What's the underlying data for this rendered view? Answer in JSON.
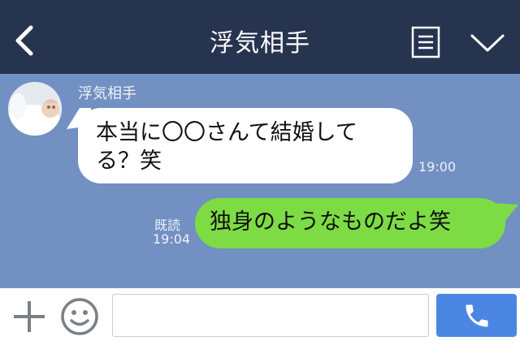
{
  "header": {
    "title": "浮気相手",
    "back_icon": "chevron-left-icon",
    "notes_icon": "notes-icon",
    "menu_icon": "chevron-down-icon",
    "background_color": "#26344f"
  },
  "chat": {
    "background_color": "#7290c2",
    "messages": [
      {
        "direction": "incoming",
        "sender": "浮気相手",
        "line1": "本当に〇〇さんて結婚して",
        "line2": "る？笑",
        "time": "19:00",
        "bubble_color": "#ffffff"
      },
      {
        "direction": "outgoing",
        "text": "独身のようなものだよ笑",
        "read_status": "既読",
        "time": "19:04",
        "bubble_color": "#7ddc44"
      }
    ]
  },
  "input_bar": {
    "plus_icon": "plus-icon",
    "emoji_icon": "smiley-icon",
    "placeholder": "",
    "call_icon": "phone-icon",
    "call_button_color": "#4b87e2"
  }
}
